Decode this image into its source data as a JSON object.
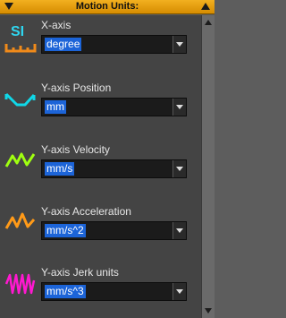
{
  "header": {
    "title": "Motion Units:"
  },
  "icons": {
    "xaxis": {
      "text": "SI",
      "color": "#2fd6f0",
      "ruler_color": "#f08a1a"
    },
    "position_color": "#10d8e8",
    "velocity_color": "#a0ff10",
    "acceleration_color": "#ff9a18",
    "jerk_color": "#ff18d0"
  },
  "rows": [
    {
      "label": "X-axis",
      "value": "degree"
    },
    {
      "label": "Y-axis Position",
      "value": "mm"
    },
    {
      "label": "Y-axis Velocity",
      "value": "mm/s"
    },
    {
      "label": "Y-axis Acceleration",
      "value": "mm/s^2"
    },
    {
      "label": "Y-axis Jerk units",
      "value": "mm/s^3"
    }
  ]
}
